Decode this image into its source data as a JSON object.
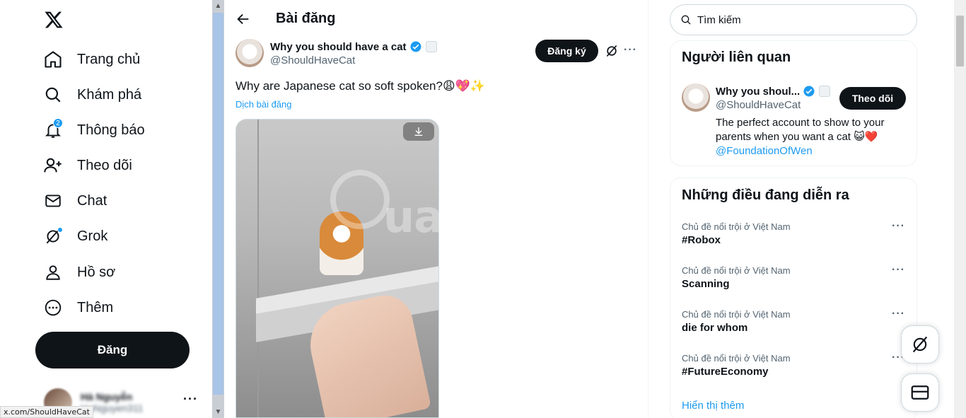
{
  "nav": {
    "items": [
      {
        "label": "Trang chủ",
        "icon": "home-icon"
      },
      {
        "label": "Khám phá",
        "icon": "search-icon"
      },
      {
        "label": "Thông báo",
        "icon": "bell-icon",
        "badge": "2"
      },
      {
        "label": "Theo dõi",
        "icon": "follow-icon"
      },
      {
        "label": "Chat",
        "icon": "mail-icon"
      },
      {
        "label": "Grok",
        "icon": "grok-icon"
      },
      {
        "label": "Hồ sơ",
        "icon": "profile-icon"
      },
      {
        "label": "Thêm",
        "icon": "more-circle-icon"
      }
    ],
    "post_label": "Đăng",
    "account_name": "Hà Nguyễn",
    "account_handle": "HaNguyen311"
  },
  "status_url": "x.com/ShouldHaveCat",
  "main": {
    "title": "Bài đăng",
    "author_name": "Why you should have a cat",
    "author_handle": "@ShouldHaveCat",
    "subscribe_label": "Đăng ký",
    "text": "Why are Japanese cat so soft spoken?😩💖✨",
    "translate_label": "Dịch bài đăng",
    "watermark": "uantrimang"
  },
  "right": {
    "search_placeholder": "Tìm kiếm",
    "related": {
      "title": "Người liên quan",
      "name": "Why you shoul...",
      "handle": "@ShouldHaveCat",
      "follow_label": "Theo dõi",
      "bio": "The perfect account to show to your parents when you want a cat 😺❤️",
      "bio_link": "@FoundationOfWen"
    },
    "trends": {
      "title": "Những điều đang diễn ra",
      "items": [
        {
          "category": "Chủ đề nổi trội ở Việt Nam",
          "name": "#Robox"
        },
        {
          "category": "Chủ đề nổi trội ở Việt Nam",
          "name": "Scanning"
        },
        {
          "category": "Chủ đề nổi trội ở Việt Nam",
          "name": "die for whom"
        },
        {
          "category": "Chủ đề nổi trội ở Việt Nam",
          "name": "#FutureEconomy"
        }
      ],
      "show_more": "Hiển thị thêm"
    }
  },
  "colors": {
    "accent": "#1d9bf0",
    "dark": "#0f1419",
    "muted": "#536471"
  }
}
